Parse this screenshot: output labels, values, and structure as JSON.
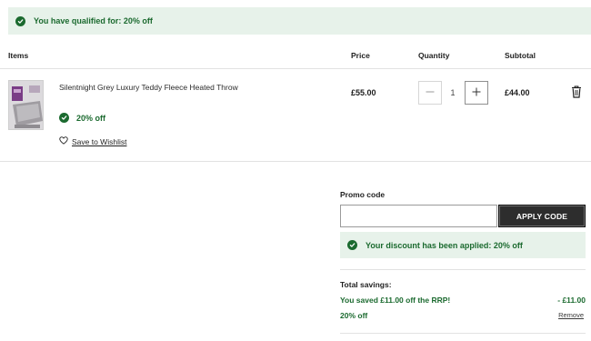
{
  "qualified_banner": {
    "message": "You have qualified for: 20% off"
  },
  "table_headers": {
    "items": "Items",
    "price": "Price",
    "quantity": "Quantity",
    "subtotal": "Subtotal"
  },
  "cart_item": {
    "name": "Silentnight Grey Luxury Teddy Fleece Heated Throw",
    "offer": "20% off",
    "wishlist_label": "Save to Wishlist",
    "price": "£55.00",
    "quantity": "1",
    "subtotal": "£44.00"
  },
  "promo": {
    "label": "Promo code",
    "input_value": "",
    "apply_label": "APPLY CODE",
    "applied_message": "Your discount has been applied: 20% off"
  },
  "savings": {
    "title": "Total savings:",
    "rrp_line": "You saved £11.00 off the RRP!",
    "rrp_amount": "- £11.00",
    "promo_line": "20% off",
    "remove_label": "Remove"
  },
  "colors": {
    "accent_green": "#1b6a2f",
    "banner_bg": "#e7f2ea",
    "button_dark": "#2d2d2d"
  }
}
